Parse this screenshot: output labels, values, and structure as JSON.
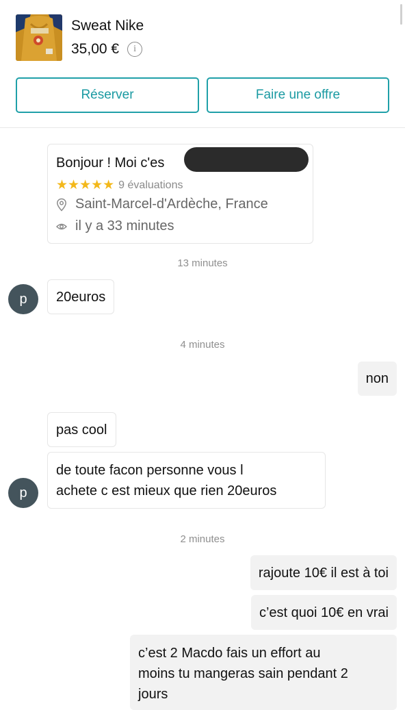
{
  "item": {
    "title": "Sweat Nike",
    "price": "35,00 €",
    "info_icon": "info-icon"
  },
  "actions": {
    "reserve_label": "Réserver",
    "offer_label": "Faire une offre"
  },
  "profile": {
    "greeting": "Bonjour ! Moi c'es",
    "stars": "★★★★★",
    "rating_count": 5,
    "reviews_label": "9 évaluations",
    "location": "Saint-Marcel-d'Ardèche, France",
    "last_seen": "il y a 33 minutes"
  },
  "colors": {
    "accent": "#1fa0a8",
    "star": "#f3b81b",
    "avatar_bg": "#44545c"
  },
  "messages": {
    "ts1": "13 minutes",
    "m1": "20euros",
    "ts2": "4 minutes",
    "m2": "non",
    "m3": "pas cool",
    "m4_line1": "de toute facon personne vous l",
    "m4_line2": "achete c est mieux que rien 20euros",
    "ts3": "2 minutes",
    "m5": "rajoute 10€ il est à toi",
    "m6": "c’est quoi 10€ en vrai",
    "m7_line1": "c’est 2 Macdo fais un effort au",
    "m7_line2": "moins tu mangeras sain pendant 2",
    "m7_line3": "jours"
  },
  "avatar_letter": "p"
}
